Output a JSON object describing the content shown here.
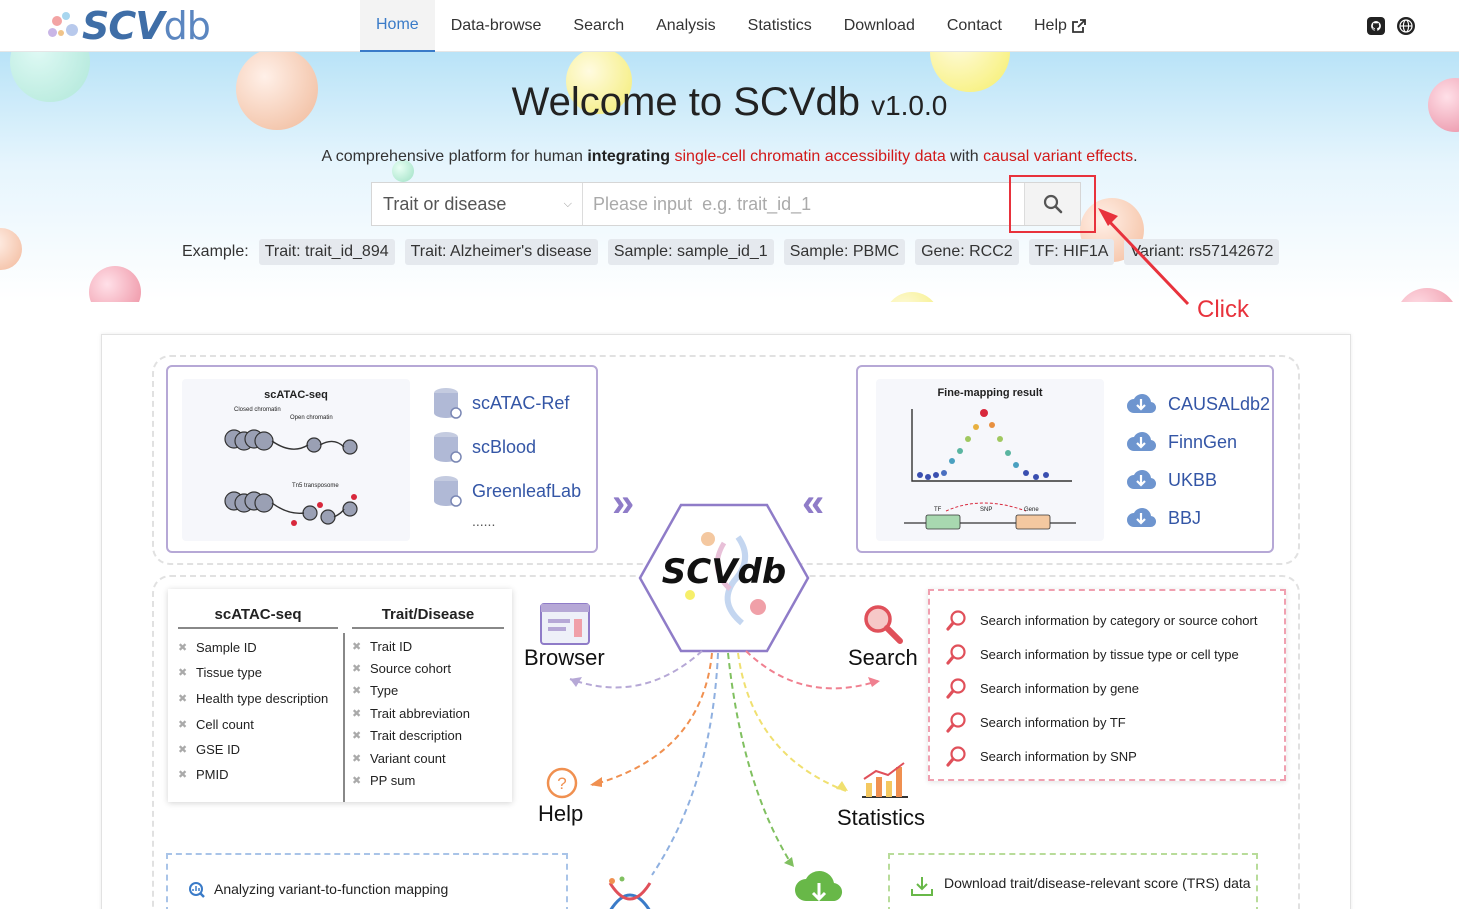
{
  "brand": {
    "logo_main": "SCV",
    "logo_db": "db"
  },
  "nav": {
    "items": [
      "Home",
      "Data-browse",
      "Search",
      "Analysis",
      "Statistics",
      "Download",
      "Contact",
      "Help"
    ],
    "active": "Home",
    "help_external_icon": "external-link-icon",
    "right_icons": [
      "github-icon",
      "globe-icon"
    ]
  },
  "hero": {
    "title": "Welcome to SCVdb",
    "version": "v1.0.0",
    "subtitle_prefix": "A comprehensive platform for human ",
    "subtitle_bold": "integrating",
    "subtitle_red1": "single-cell chromatin accessibility data",
    "subtitle_mid": " with ",
    "subtitle_red2": "causal variant effects",
    "subtitle_end": "."
  },
  "search": {
    "select_value": "Trait or disease",
    "input_placeholder": "Please input  e.g. trait_id_1",
    "button_icon": "search-icon"
  },
  "examples": {
    "label": "Example:",
    "chips": [
      "Trait: trait_id_894",
      "Trait: Alzheimer's disease",
      "Sample: sample_id_1",
      "Sample: PBMC",
      "Gene: RCC2",
      "TF: HIF1A",
      "Variant: rs57142672"
    ]
  },
  "annotation": {
    "click_label": "Click",
    "highlight_color": "#e8323c"
  },
  "diagram": {
    "scatac_title": "scATAC-seq",
    "scatac_labels": {
      "closed": "Closed chromatin",
      "open": "Open chromatin",
      "tn5": "Tn5 transposome"
    },
    "ref_dbs": [
      "scATAC-Ref",
      "scBlood",
      "GreenleafLab"
    ],
    "ref_more": "......",
    "finemap_title": "Fine-mapping result",
    "finemap_labels": {
      "tf": "TF",
      "snp": "SNP",
      "gene": "Gene"
    },
    "gwas_dbs": [
      "CAUSALdb2",
      "FinnGen",
      "UKBB",
      "BBJ"
    ],
    "center": "SCVdb",
    "table_col1_title": "scATAC-seq",
    "table_col1": [
      "Sample ID",
      "Tissue type",
      "Health type description",
      "Cell count",
      "GSE ID",
      "PMID"
    ],
    "table_col2_title": "Trait/Disease",
    "table_col2": [
      "Trait ID",
      "Source cohort",
      "Type",
      "Trait abbreviation",
      "Trait description",
      "Variant count",
      "PP sum"
    ],
    "browser": "Browser",
    "search_label": "Search",
    "search_items": [
      "Search information by category or source cohort",
      "Search information by tissue type or cell type",
      "Search information by gene",
      "Search information by TF",
      "Search information by SNP"
    ],
    "help": "Help",
    "statistics": "Statistics",
    "analysis_item": "Analyzing variant-to-function mapping",
    "download_item": "Download trait/disease-relevant score (TRS) data"
  }
}
